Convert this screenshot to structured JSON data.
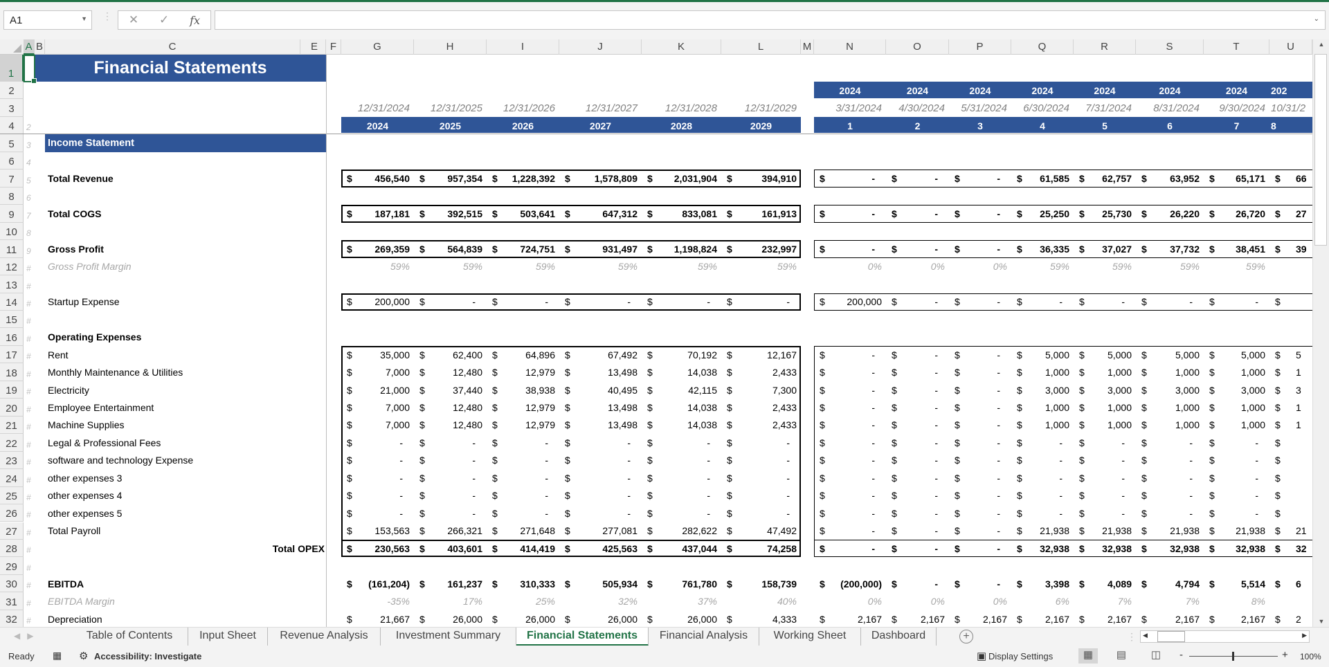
{
  "formula_bar": {
    "name_box": "A1",
    "cancel_icon": "✕",
    "enter_icon": "✓",
    "fx_label": "fx",
    "formula": ""
  },
  "columns": [
    "A",
    "B",
    "C",
    "E",
    "F",
    "G",
    "H",
    "I",
    "J",
    "K",
    "L",
    "M",
    "N",
    "O",
    "P",
    "Q",
    "R",
    "S",
    "T",
    "U"
  ],
  "selected_cell": "A1",
  "colors": {
    "header_blue": "#2F5597",
    "excel_green": "#217346",
    "muted_text": "#A6A6A6"
  },
  "sheet": {
    "title": "Financial Statements",
    "section": "Income Statement",
    "annual": {
      "dates": [
        "12/31/2024",
        "12/31/2025",
        "12/31/2026",
        "12/31/2027",
        "12/31/2028",
        "12/31/2029"
      ],
      "years": [
        "2024",
        "2025",
        "2026",
        "2027",
        "2028",
        "2029"
      ]
    },
    "monthly": {
      "years": [
        "2024",
        "2024",
        "2024",
        "2024",
        "2024",
        "2024",
        "2024",
        "202"
      ],
      "dates": [
        "3/31/2024",
        "4/30/2024",
        "5/31/2024",
        "6/30/2024",
        "7/31/2024",
        "8/31/2024",
        "9/30/2024",
        "10/31/2"
      ],
      "periods": [
        "1",
        "2",
        "3",
        "4",
        "5",
        "6",
        "7",
        "8"
      ]
    },
    "row_numbers": [
      "1",
      "2",
      "3",
      "4",
      "5",
      "6",
      "7",
      "8",
      "9",
      "10",
      "11",
      "12",
      "13",
      "14",
      "15",
      "16",
      "17",
      "18",
      "19",
      "20",
      "21",
      "22",
      "23",
      "24",
      "25",
      "26",
      "27",
      "28",
      "29",
      "30",
      "31",
      "32"
    ],
    "row_index": [
      "",
      "",
      "",
      "2",
      "3",
      "4",
      "5",
      "6",
      "7",
      "8",
      "9",
      "#",
      "#",
      "#",
      "#",
      "#",
      "#",
      "#",
      "#",
      "#",
      "#",
      "#",
      "#",
      "#",
      "#",
      "#",
      "#",
      "#",
      "#",
      "#",
      "#",
      "#"
    ],
    "lines": [
      {
        "row": 7,
        "label": "Total Revenue",
        "style": "total",
        "annual": [
          "456,540",
          "957,354",
          "1,228,392",
          "1,578,809",
          "2,031,904",
          "394,910"
        ],
        "monthly": [
          "-",
          "-",
          "-",
          "61,585",
          "62,757",
          "63,952",
          "65,171",
          "66"
        ]
      },
      {
        "row": 9,
        "label": "Total COGS",
        "style": "total",
        "annual": [
          "187,181",
          "392,515",
          "503,641",
          "647,312",
          "833,081",
          "161,913"
        ],
        "monthly": [
          "-",
          "-",
          "-",
          "25,250",
          "25,730",
          "26,220",
          "26,720",
          "27"
        ]
      },
      {
        "row": 11,
        "label": "Gross Profit",
        "style": "total",
        "annual": [
          "269,359",
          "564,839",
          "724,751",
          "931,497",
          "1,198,824",
          "232,997"
        ],
        "monthly": [
          "-",
          "-",
          "-",
          "36,335",
          "37,027",
          "37,732",
          "38,451",
          "39"
        ]
      },
      {
        "row": 12,
        "label": "Gross Profit Margin",
        "style": "pct",
        "annual": [
          "59%",
          "59%",
          "59%",
          "59%",
          "59%",
          "59%"
        ],
        "monthly": [
          "0%",
          "0%",
          "0%",
          "59%",
          "59%",
          "59%",
          "59%"
        ]
      },
      {
        "row": 14,
        "label": "Startup Expense",
        "style": "item",
        "annual": [
          "200,000",
          "-",
          "-",
          "-",
          "-",
          "-"
        ],
        "monthly": [
          "200,000",
          "-",
          "-",
          "-",
          "-",
          "-",
          "-",
          ""
        ]
      },
      {
        "row": 16,
        "label": "Operating Expenses",
        "style": "heading",
        "annual": [],
        "monthly": []
      },
      {
        "row": 17,
        "label": "Rent",
        "style": "item",
        "annual": [
          "35,000",
          "62,400",
          "64,896",
          "67,492",
          "70,192",
          "12,167"
        ],
        "monthly": [
          "-",
          "-",
          "-",
          "5,000",
          "5,000",
          "5,000",
          "5,000",
          "5"
        ]
      },
      {
        "row": 18,
        "label": "Monthly Maintenance & Utilities",
        "style": "item",
        "annual": [
          "7,000",
          "12,480",
          "12,979",
          "13,498",
          "14,038",
          "2,433"
        ],
        "monthly": [
          "-",
          "-",
          "-",
          "1,000",
          "1,000",
          "1,000",
          "1,000",
          "1"
        ]
      },
      {
        "row": 19,
        "label": "Electricity",
        "style": "item",
        "annual": [
          "21,000",
          "37,440",
          "38,938",
          "40,495",
          "42,115",
          "7,300"
        ],
        "monthly": [
          "-",
          "-",
          "-",
          "3,000",
          "3,000",
          "3,000",
          "3,000",
          "3"
        ]
      },
      {
        "row": 20,
        "label": "Employee Entertainment",
        "style": "item",
        "annual": [
          "7,000",
          "12,480",
          "12,979",
          "13,498",
          "14,038",
          "2,433"
        ],
        "monthly": [
          "-",
          "-",
          "-",
          "1,000",
          "1,000",
          "1,000",
          "1,000",
          "1"
        ]
      },
      {
        "row": 21,
        "label": "Machine Supplies",
        "style": "item",
        "annual": [
          "7,000",
          "12,480",
          "12,979",
          "13,498",
          "14,038",
          "2,433"
        ],
        "monthly": [
          "-",
          "-",
          "-",
          "1,000",
          "1,000",
          "1,000",
          "1,000",
          "1"
        ]
      },
      {
        "row": 22,
        "label": "Legal & Professional Fees",
        "style": "item",
        "annual": [
          "-",
          "-",
          "-",
          "-",
          "-",
          "-"
        ],
        "monthly": [
          "-",
          "-",
          "-",
          "-",
          "-",
          "-",
          "-",
          ""
        ]
      },
      {
        "row": 23,
        "label": "software and technology Expense",
        "style": "item",
        "annual": [
          "-",
          "-",
          "-",
          "-",
          "-",
          "-"
        ],
        "monthly": [
          "-",
          "-",
          "-",
          "-",
          "-",
          "-",
          "-",
          ""
        ]
      },
      {
        "row": 24,
        "label": "other expenses 3",
        "style": "item",
        "annual": [
          "-",
          "-",
          "-",
          "-",
          "-",
          "-"
        ],
        "monthly": [
          "-",
          "-",
          "-",
          "-",
          "-",
          "-",
          "-",
          ""
        ]
      },
      {
        "row": 25,
        "label": "other expenses 4",
        "style": "item",
        "annual": [
          "-",
          "-",
          "-",
          "-",
          "-",
          "-"
        ],
        "monthly": [
          "-",
          "-",
          "-",
          "-",
          "-",
          "-",
          "-",
          ""
        ]
      },
      {
        "row": 26,
        "label": "other expenses 5",
        "style": "item",
        "annual": [
          "-",
          "-",
          "-",
          "-",
          "-",
          "-"
        ],
        "monthly": [
          "-",
          "-",
          "-",
          "-",
          "-",
          "-",
          "-",
          ""
        ]
      },
      {
        "row": 27,
        "label": "Total Payroll",
        "style": "item",
        "annual": [
          "153,563",
          "266,321",
          "271,648",
          "277,081",
          "282,622",
          "47,492"
        ],
        "monthly": [
          "-",
          "-",
          "-",
          "21,938",
          "21,938",
          "21,938",
          "21,938",
          "21"
        ]
      },
      {
        "row": 28,
        "label": "Total OPEX",
        "style": "opex",
        "annual": [
          "230,563",
          "403,601",
          "414,419",
          "425,563",
          "437,044",
          "74,258"
        ],
        "monthly": [
          "-",
          "-",
          "-",
          "32,938",
          "32,938",
          "32,938",
          "32,938",
          "32"
        ]
      },
      {
        "row": 30,
        "label": "EBITDA",
        "style": "total",
        "annual": [
          "(161,204)",
          "161,237",
          "310,333",
          "505,934",
          "761,780",
          "158,739"
        ],
        "monthly": [
          "(200,000)",
          "-",
          "-",
          "3,398",
          "4,089",
          "4,794",
          "5,514",
          "6"
        ]
      },
      {
        "row": 31,
        "label": "EBITDA Margin",
        "style": "pct",
        "annual": [
          "-35%",
          "17%",
          "25%",
          "32%",
          "37%",
          "40%"
        ],
        "monthly": [
          "0%",
          "0%",
          "0%",
          "6%",
          "7%",
          "7%",
          "8%"
        ]
      },
      {
        "row": 32,
        "label": "Depreciation",
        "style": "item",
        "annual": [
          "21,667",
          "26,000",
          "26,000",
          "26,000",
          "26,000",
          "4,333"
        ],
        "monthly": [
          "2,167",
          "2,167",
          "2,167",
          "2,167",
          "2,167",
          "2,167",
          "2,167",
          "2"
        ]
      }
    ]
  },
  "sheet_tabs": [
    {
      "label": "Table of Contents",
      "active": false
    },
    {
      "label": "Input Sheet",
      "active": false
    },
    {
      "label": "Revenue Analysis",
      "active": false
    },
    {
      "label": "Investment Summary",
      "active": false
    },
    {
      "label": "Financial Statements",
      "active": true
    },
    {
      "label": "Financial Analysis",
      "active": false
    },
    {
      "label": "Working Sheet",
      "active": false
    },
    {
      "label": "Dashboard",
      "active": false
    }
  ],
  "status_bar": {
    "ready": "Ready",
    "accessibility": "Accessibility: Investigate",
    "display_settings": "Display Settings",
    "zoom": "100%",
    "zoom_minus": "-",
    "zoom_plus": "+"
  }
}
